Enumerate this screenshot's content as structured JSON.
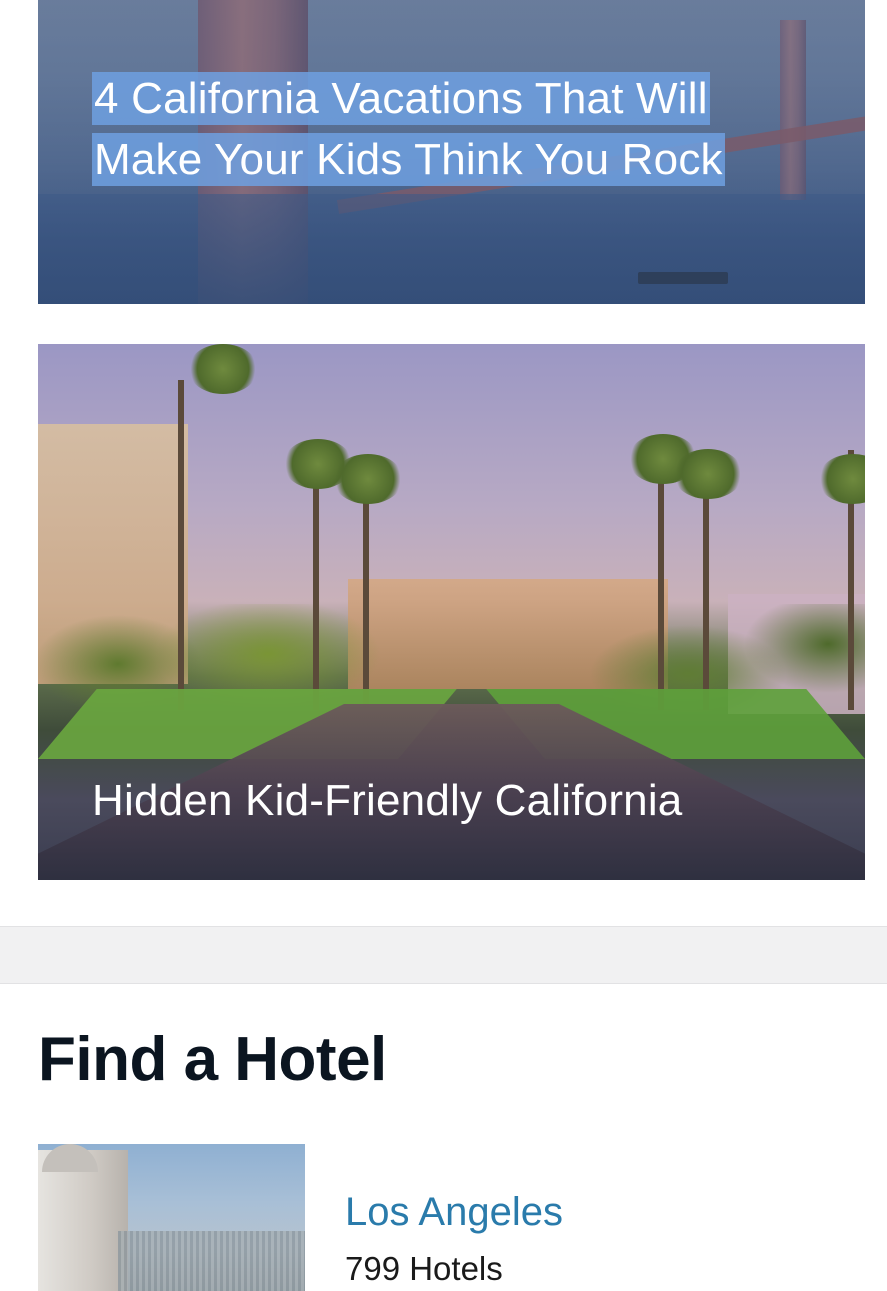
{
  "articles": [
    {
      "title": "4 California Vacations That Will Make Your Kids Think You Rock"
    },
    {
      "title": "Hidden Kid-Friendly California"
    }
  ],
  "find_hotel": {
    "heading": "Find a Hotel",
    "items": [
      {
        "city": "Los Angeles",
        "count": "799 Hotels"
      }
    ]
  },
  "colors": {
    "link": "#2a7bab",
    "heading": "#0b1520",
    "selection": "#6ea0e1",
    "divider": "#f1f1f2"
  }
}
